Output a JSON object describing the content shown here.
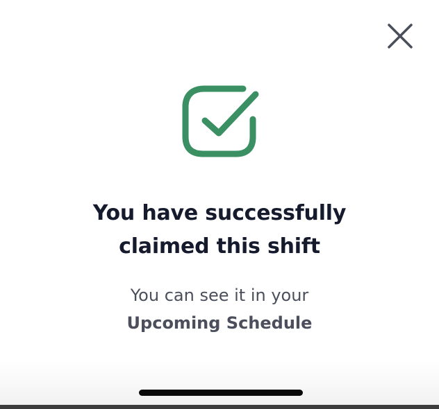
{
  "dialog": {
    "title_line1": "You have successfully",
    "title_line2": "claimed this shift",
    "message_line1": "You can see it in your",
    "message_link": "Upcoming Schedule"
  },
  "icons": {
    "close": "close-icon",
    "success": "checkmark-square-icon"
  },
  "colors": {
    "success_green": "#3a8f63",
    "title_text": "#151a2d",
    "body_text": "#4b4f5c",
    "close_icon": "#4a4e5a"
  }
}
